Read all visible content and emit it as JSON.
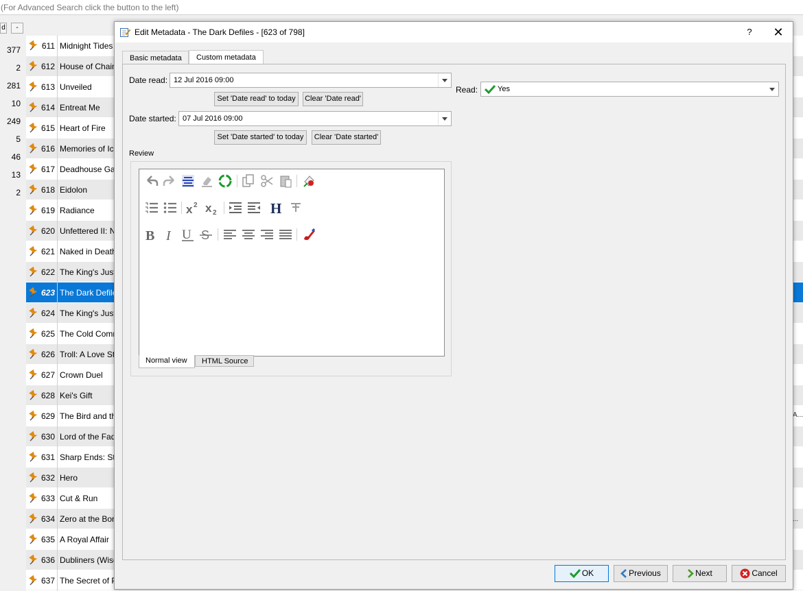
{
  "main": {
    "search_placeholder": "(For Advanced Search click the button to the left)",
    "mini_buttons": [
      "d",
      "-"
    ],
    "counts": [
      "377",
      "2",
      "281",
      "10",
      "249",
      "5",
      "46",
      "13",
      "2"
    ],
    "books": [
      {
        "num": "611",
        "title": "Midnight Tides"
      },
      {
        "num": "612",
        "title": "House of Chains"
      },
      {
        "num": "613",
        "title": "Unveiled"
      },
      {
        "num": "614",
        "title": "Entreat Me"
      },
      {
        "num": "615",
        "title": "Heart of Fire"
      },
      {
        "num": "616",
        "title": "Memories of Ice"
      },
      {
        "num": "617",
        "title": "Deadhouse Gates"
      },
      {
        "num": "618",
        "title": "Eidolon"
      },
      {
        "num": "619",
        "title": "Radiance"
      },
      {
        "num": "620",
        "title": "Unfettered II: N"
      },
      {
        "num": "621",
        "title": "Naked in Death"
      },
      {
        "num": "622",
        "title": "The King's Justice"
      },
      {
        "num": "623",
        "title": "The Dark Defiles"
      },
      {
        "num": "624",
        "title": "The King's Justice"
      },
      {
        "num": "625",
        "title": "The Cold Commands"
      },
      {
        "num": "626",
        "title": "Troll: A Love Story"
      },
      {
        "num": "627",
        "title": "Crown Duel"
      },
      {
        "num": "628",
        "title": "Kei's Gift"
      },
      {
        "num": "629",
        "title": "The Bird and the"
      },
      {
        "num": "630",
        "title": "Lord of the Fading"
      },
      {
        "num": "631",
        "title": "Sharp Ends: Stories"
      },
      {
        "num": "632",
        "title": "Hero"
      },
      {
        "num": "633",
        "title": "Cut & Run"
      },
      {
        "num": "634",
        "title": "Zero at the Bone"
      },
      {
        "num": "635",
        "title": "A Royal Affair"
      },
      {
        "num": "636",
        "title": "Dubliners (Wisehouse"
      },
      {
        "num": "637",
        "title": "The Secret of P"
      }
    ],
    "right_clips": [
      "A...",
      "..."
    ]
  },
  "dialog": {
    "title": "Edit Metadata - The Dark Defiles -  [623 of 798]",
    "help": "?",
    "close": "✕",
    "tabs": [
      "Basic metadata",
      "Custom metadata"
    ],
    "date_read_label": "Date read:",
    "date_read_value": "12 Jul 2016 09:00",
    "set_date_read_today": "Set 'Date read' to today",
    "clear_date_read": "Clear 'Date read'",
    "date_started_label": "Date started:",
    "date_started_value": "07 Jul 2016 09:00",
    "set_date_started_today": "Set 'Date started' to today",
    "clear_date_started": "Clear 'Date started'",
    "read_label": "Read:",
    "read_value": "Yes",
    "review_label": "Review",
    "editor_tabs": [
      "Normal view",
      "HTML Source"
    ],
    "buttons": {
      "ok": "OK",
      "previous": "Previous",
      "next": "Next",
      "cancel": "Cancel"
    }
  },
  "colors": {
    "selection": "#0a78d7",
    "pin": "#e08a12",
    "ok_check": "#1f9a2f",
    "cancel_red": "#d42020"
  }
}
